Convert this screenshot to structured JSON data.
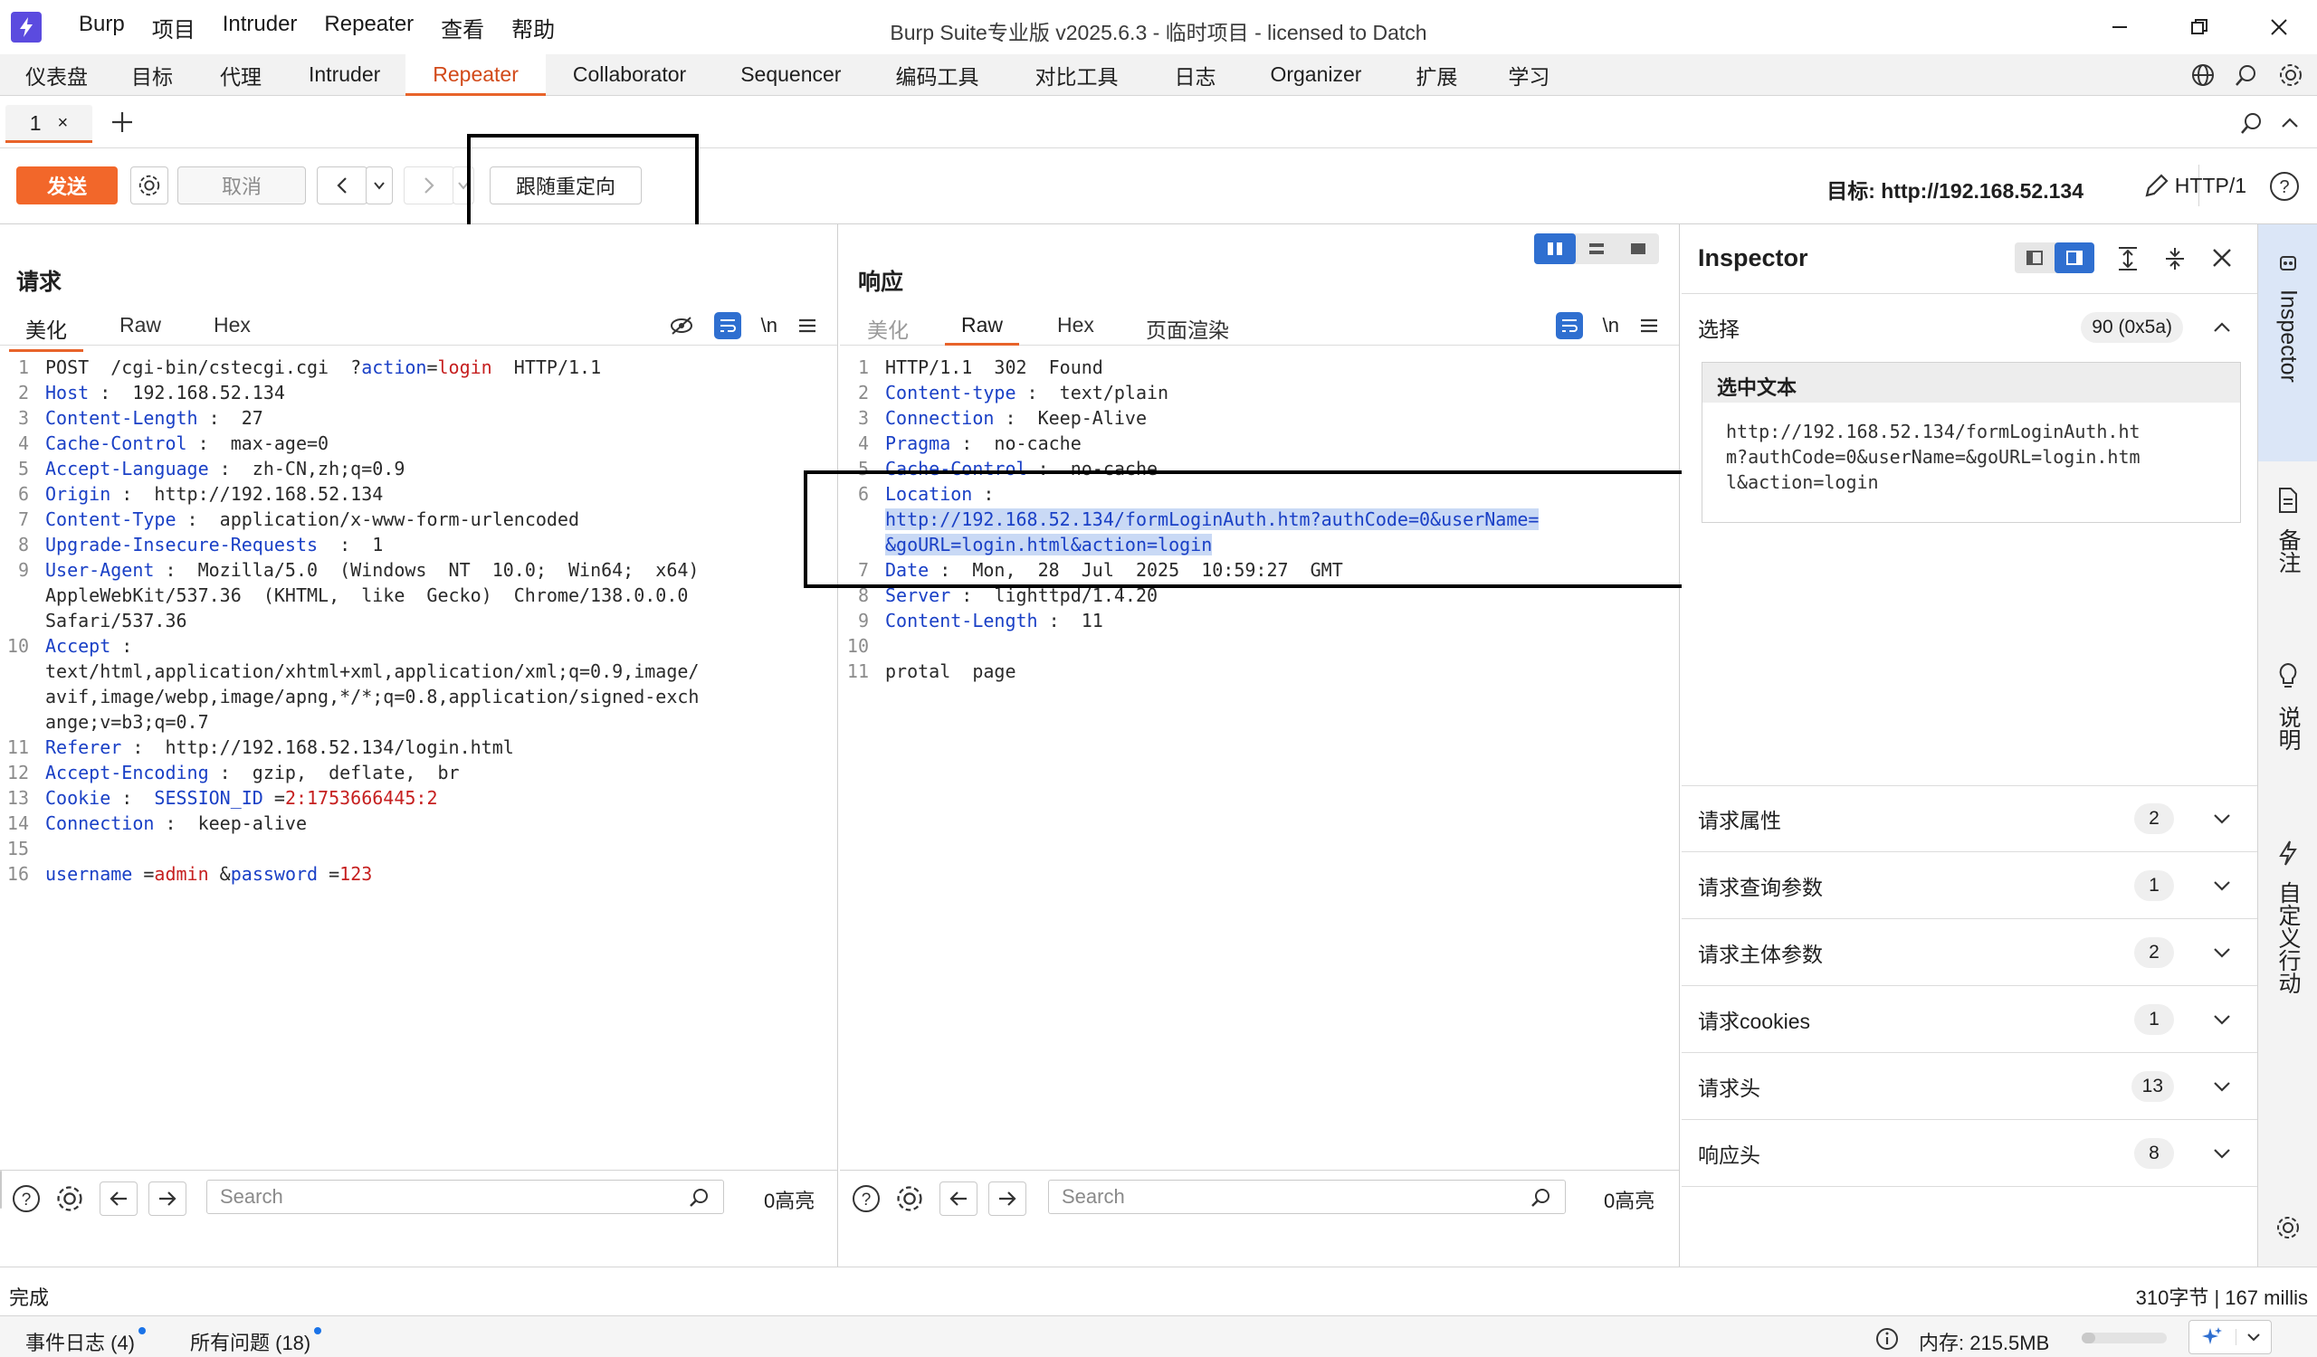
{
  "menu": [
    "Burp",
    "项目",
    "Intruder",
    "Repeater",
    "查看",
    "帮助"
  ],
  "window_title": "Burp Suite专业版  v2025.6.3 - 临时项目 - licensed to Datch",
  "tool_tabs": [
    "仪表盘",
    "目标",
    "代理",
    "Intruder",
    "Repeater",
    "Collaborator",
    "Sequencer",
    "编码工具",
    "对比工具",
    "日志",
    "Organizer",
    "扩展",
    "学习"
  ],
  "active_tool_tab": "Repeater",
  "repeater_tab": {
    "label": "1",
    "close": "×"
  },
  "toolbar": {
    "send": "发送",
    "cancel": "取消",
    "follow_redirect": "跟随重定向",
    "target_label": "目标: http://192.168.52.134",
    "http_version": "HTTP/1"
  },
  "request": {
    "title": "请求",
    "tabs": [
      "美化",
      "Raw",
      "Hex"
    ],
    "wrap_icon": "\\n",
    "lines": [
      {
        "n": "1",
        "parts": [
          [
            "t",
            "POST  /cgi-bin/cstecgi.cgi  ?"
          ],
          [
            "k",
            "action"
          ],
          [
            "t",
            "="
          ],
          [
            "v",
            "login"
          ],
          [
            "t",
            "  HTTP/1.1"
          ]
        ]
      },
      {
        "n": "2",
        "parts": [
          [
            "k",
            "Host"
          ],
          [
            "t",
            " :  192.168.52.134"
          ]
        ]
      },
      {
        "n": "3",
        "parts": [
          [
            "k",
            "Content-Length"
          ],
          [
            "t",
            " :  27"
          ]
        ]
      },
      {
        "n": "4",
        "parts": [
          [
            "k",
            "Cache-Control"
          ],
          [
            "t",
            " :  max-age=0"
          ]
        ]
      },
      {
        "n": "5",
        "parts": [
          [
            "k",
            "Accept-Language"
          ],
          [
            "t",
            " :  zh-CN,zh;q=0.9"
          ]
        ]
      },
      {
        "n": "6",
        "parts": [
          [
            "k",
            "Origin"
          ],
          [
            "t",
            " :  http://192.168.52.134"
          ]
        ]
      },
      {
        "n": "7",
        "parts": [
          [
            "k",
            "Content-Type"
          ],
          [
            "t",
            " :  application/x-www-form-urlencoded"
          ]
        ]
      },
      {
        "n": "8",
        "parts": [
          [
            "k",
            "Upgrade-Insecure-Requests"
          ],
          [
            "t",
            "  :  1"
          ]
        ]
      },
      {
        "n": "9",
        "parts": [
          [
            "k",
            "User-Agent"
          ],
          [
            "t",
            " :  Mozilla/5.0  (Windows  NT  10.0;  Win64;  x64)"
          ]
        ]
      },
      {
        "n": "",
        "parts": [
          [
            "t",
            "AppleWebKit/537.36  (KHTML,  like  Gecko)  Chrome/138.0.0.0"
          ]
        ]
      },
      {
        "n": "",
        "parts": [
          [
            "t",
            "Safari/537.36"
          ]
        ]
      },
      {
        "n": "10",
        "parts": [
          [
            "k",
            "Accept"
          ],
          [
            "t",
            " :"
          ]
        ]
      },
      {
        "n": "",
        "parts": [
          [
            "t",
            "text/html,application/xhtml+xml,application/xml;q=0.9,image/"
          ]
        ]
      },
      {
        "n": "",
        "parts": [
          [
            "t",
            "avif,image/webp,image/apng,*/*;q=0.8,application/signed-exch"
          ]
        ]
      },
      {
        "n": "",
        "parts": [
          [
            "t",
            "ange;v=b3;q=0.7"
          ]
        ]
      },
      {
        "n": "11",
        "parts": [
          [
            "k",
            "Referer"
          ],
          [
            "t",
            " :  http://192.168.52.134/login.html"
          ]
        ]
      },
      {
        "n": "12",
        "parts": [
          [
            "k",
            "Accept-Encoding"
          ],
          [
            "t",
            " :  gzip,  deflate,  br"
          ]
        ]
      },
      {
        "n": "13",
        "parts": [
          [
            "k",
            "Cookie"
          ],
          [
            "t",
            " :  "
          ],
          [
            "k",
            "SESSION_ID"
          ],
          [
            "t",
            " ="
          ],
          [
            "v",
            "2:1753666445:2"
          ]
        ]
      },
      {
        "n": "14",
        "parts": [
          [
            "k",
            "Connection"
          ],
          [
            "t",
            " :  keep-alive"
          ]
        ]
      },
      {
        "n": "15",
        "parts": []
      },
      {
        "n": "16",
        "parts": [
          [
            "k",
            "username"
          ],
          [
            "t",
            " ="
          ],
          [
            "v",
            "admin"
          ],
          [
            "t",
            " &"
          ],
          [
            "k",
            "password"
          ],
          [
            "t",
            " ="
          ],
          [
            "v",
            "123"
          ]
        ]
      }
    ],
    "search_placeholder": "Search",
    "hits": "0高亮"
  },
  "response": {
    "title": "响应",
    "tabs": [
      "美化",
      "Raw",
      "Hex",
      "页面渲染"
    ],
    "wrap_icon": "\\n",
    "lines": [
      {
        "n": "1",
        "parts": [
          [
            "t",
            "HTTP/1.1  302  Found"
          ]
        ]
      },
      {
        "n": "2",
        "parts": [
          [
            "k",
            "Content-type"
          ],
          [
            "t",
            " :  text/plain"
          ]
        ]
      },
      {
        "n": "3",
        "parts": [
          [
            "k",
            "Connection"
          ],
          [
            "t",
            " :  Keep-Alive"
          ]
        ]
      },
      {
        "n": "4",
        "parts": [
          [
            "k",
            "Pragma"
          ],
          [
            "t",
            " :  no-cache"
          ]
        ]
      },
      {
        "n": "5",
        "parts": [
          [
            "k",
            "Cache-Control"
          ],
          [
            "t",
            " :  no-cache"
          ]
        ]
      },
      {
        "n": "6",
        "parts": [
          [
            "k",
            "Location"
          ],
          [
            "t",
            " :"
          ]
        ]
      },
      {
        "n": "",
        "parts": [
          [
            "s",
            "http://192.168.52.134/formLoginAuth.htm?authCode=0&userName="
          ]
        ]
      },
      {
        "n": "",
        "parts": [
          [
            "s",
            "&goURL=login.html&action=login"
          ]
        ]
      },
      {
        "n": "7",
        "parts": [
          [
            "k",
            "Date"
          ],
          [
            "t",
            " :  Mon,  28  Jul  2025  10:59:27  GMT"
          ]
        ]
      },
      {
        "n": "8",
        "parts": [
          [
            "k",
            "Server"
          ],
          [
            "t",
            " :  lighttpd/1.4.20"
          ]
        ]
      },
      {
        "n": "9",
        "parts": [
          [
            "k",
            "Content-Length"
          ],
          [
            "t",
            " :  11"
          ]
        ]
      },
      {
        "n": "10",
        "parts": []
      },
      {
        "n": "11",
        "parts": [
          [
            "t",
            "protal  page"
          ]
        ]
      }
    ],
    "search_placeholder": "Search",
    "hits": "0高亮"
  },
  "inspector": {
    "title": "Inspector",
    "selection_label": "选择",
    "selection_count": "90 (0x5a)",
    "selected_text_label": "选中文本",
    "selected_text": "http://192.168.52.134/formLoginAuth.ht\nm?authCode=0&userName=&goURL=login.htm\nl&action=login",
    "sections": [
      {
        "label": "请求属性",
        "count": "2"
      },
      {
        "label": "请求查询参数",
        "count": "1"
      },
      {
        "label": "请求主体参数",
        "count": "2"
      },
      {
        "label": "请求cookies",
        "count": "1"
      },
      {
        "label": "请求头",
        "count": "13"
      },
      {
        "label": "响应头",
        "count": "8"
      }
    ]
  },
  "sidebar": [
    "Inspector",
    "备注",
    "说明",
    "自定义行动"
  ],
  "status": {
    "left": "完成",
    "right": "310字节 | 167 millis"
  },
  "footer": {
    "event_log": "事件日志 (4)",
    "issues": "所有问题 (18)",
    "memory": "内存: 215.5MB"
  },
  "colors": {
    "accent": "#e8632a",
    "send": "#f2672a",
    "header_key": "#1a40c6",
    "param_value": "#c62020",
    "selection": "#c9d9f5"
  }
}
